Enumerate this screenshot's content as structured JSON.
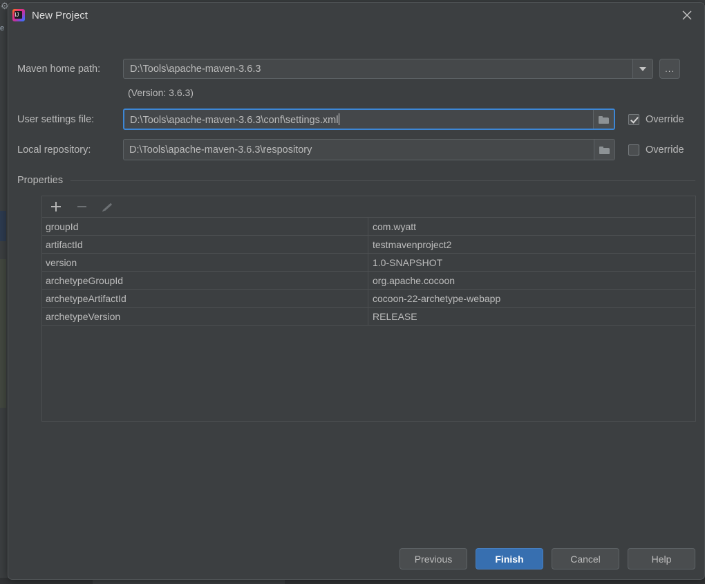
{
  "ide_background": {
    "top_strip_text": "",
    "gear_icon": "gear-icon",
    "left_label": "e"
  },
  "dialog": {
    "title": "New Project",
    "app_icon": "intellij-idea-logo-icon",
    "close_icon": "close-icon",
    "form": {
      "maven_home": {
        "label": "Maven home path:",
        "value": "D:\\Tools\\apache-maven-3.6.3",
        "dropdown_icon": "chevron-down-icon",
        "browse_label": "...",
        "version_note": "(Version: 3.6.3)"
      },
      "user_settings": {
        "label": "User settings file:",
        "value": "D:\\Tools\\apache-maven-3.6.3\\conf\\settings.xml",
        "browse_icon": "folder-icon",
        "override_label": "Override",
        "override_checked": true,
        "focused": true
      },
      "local_repository": {
        "label": "Local repository:",
        "value": "D:\\Tools\\apache-maven-3.6.3\\respository",
        "browse_icon": "folder-icon",
        "override_label": "Override",
        "override_checked": false,
        "focused": false
      }
    },
    "properties": {
      "group_title": "Properties",
      "toolbar": {
        "add_icon": "plus-icon",
        "remove_icon": "minus-icon",
        "edit_icon": "pencil-icon"
      },
      "rows": [
        {
          "key": "groupId",
          "value": "com.wyatt"
        },
        {
          "key": "artifactId",
          "value": "testmavenproject2"
        },
        {
          "key": "version",
          "value": "1.0-SNAPSHOT"
        },
        {
          "key": "archetypeGroupId",
          "value": "org.apache.cocoon"
        },
        {
          "key": "archetypeArtifactId",
          "value": "cocoon-22-archetype-webapp"
        },
        {
          "key": "archetypeVersion",
          "value": "RELEASE"
        }
      ]
    },
    "footer": {
      "previous": "Previous",
      "finish": "Finish",
      "cancel": "Cancel",
      "help": "Help"
    }
  },
  "colors": {
    "dialog_bg": "#3c3f41",
    "field_bg": "#45484a",
    "text": "#bbbbbb",
    "focus_border": "#3d87d6",
    "primary_button": "#376fb0"
  }
}
